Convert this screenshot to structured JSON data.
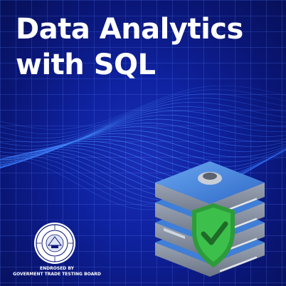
{
  "title": {
    "line1": "Data Analytics",
    "line2": "with SQL"
  },
  "endorsement": {
    "line1": "ENDROSED BY",
    "line2": "GOVERMENT TRADE TESTING BOARD"
  },
  "icons": {
    "database": "database-server-icon",
    "security": "shield-check-icon",
    "emblem": "board-seal-icon"
  },
  "colors": {
    "background": "#0f22a0",
    "title_text": "#ffffff",
    "server_body": "#3f7fd8",
    "shield": "#3cb043"
  }
}
